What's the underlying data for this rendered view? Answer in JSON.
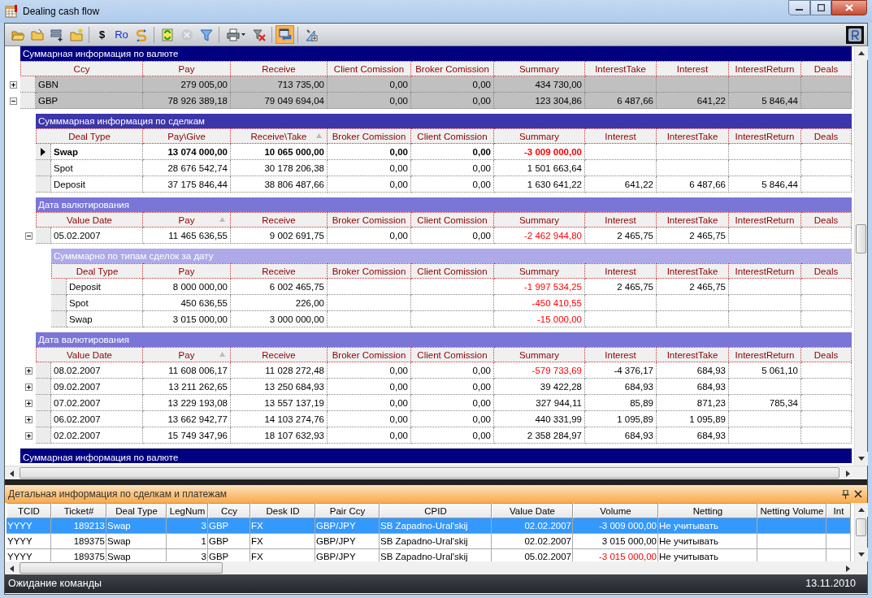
{
  "window": {
    "title": "Dealing cash flow"
  },
  "toolbar": [
    {
      "kind": "icon",
      "on": false,
      "disabled": false
    },
    {
      "kind": "icon",
      "on": false,
      "disabled": false
    },
    {
      "kind": "icon",
      "on": false,
      "disabled": false
    },
    {
      "kind": "icon",
      "on": false,
      "disabled": false
    },
    {
      "kind": "separator"
    },
    {
      "kind": "text",
      "label": "$"
    },
    {
      "kind": "text",
      "label": "Ro"
    },
    {
      "kind": "icon",
      "on": false,
      "disabled": false
    },
    {
      "kind": "separator"
    },
    {
      "kind": "icon",
      "on": false,
      "disabled": false
    },
    {
      "kind": "icon",
      "on": false,
      "disabled": true
    },
    {
      "kind": "icon",
      "on": false,
      "disabled": false
    },
    {
      "kind": "separator"
    },
    {
      "kind": "icon",
      "on": false,
      "disabled": false
    },
    {
      "kind": "icon",
      "on": false,
      "disabled": false
    },
    {
      "kind": "separator"
    },
    {
      "kind": "icon",
      "on": true,
      "disabled": false
    },
    {
      "kind": "separator"
    },
    {
      "kind": "icon",
      "on": false,
      "disabled": false
    }
  ],
  "grid": {
    "bands": [
      {
        "kind": "currency",
        "caption": "Суммарная информация по валюте",
        "columns": [
          {
            "label": "Ccy",
            "sorted": false
          },
          {
            "label": "Pay",
            "sorted": false
          },
          {
            "label": "Receive",
            "sorted": false
          },
          {
            "label": "Client Comission",
            "sorted": false
          },
          {
            "label": "Broker Comission",
            "sorted": false
          },
          {
            "label": "Summary",
            "sorted": false
          },
          {
            "label": "InterestTake",
            "sorted": false
          },
          {
            "label": "Interest",
            "sorted": false
          },
          {
            "label": "InterestReturn",
            "sorted": false
          },
          {
            "label": "Deals",
            "sorted": false
          }
        ],
        "rows": [
          {
            "expanded": false,
            "cells": [
              "GBN",
              "279 005,00",
              "713 735,00",
              "0,00",
              "0,00",
              "434 730,00",
              null,
              null,
              null,
              null
            ]
          },
          {
            "expanded": true,
            "cells": [
              "GBP",
              "78 926 389,18",
              "79 049 694,04",
              "0,00",
              "0,00",
              "123 304,86",
              "6 487,66",
              "641,22",
              "5 846,44",
              null
            ],
            "children": [
              {
                "kind": "deals",
                "caption": "Сумммарная информация по сделкам",
                "columns": [
                  {
                    "label": "Deal Type",
                    "sorted": false
                  },
                  {
                    "label": "Pay\\Give",
                    "sorted": false
                  },
                  {
                    "label": "Receive\\Take",
                    "sorted": true
                  },
                  {
                    "label": "Broker Comission",
                    "sorted": false
                  },
                  {
                    "label": "Client Comission",
                    "sorted": false
                  },
                  {
                    "label": "Summary",
                    "sorted": false
                  },
                  {
                    "label": "Interest",
                    "sorted": false
                  },
                  {
                    "label": "InterestTake",
                    "sorted": false
                  },
                  {
                    "label": "InterestReturn",
                    "sorted": false
                  },
                  {
                    "label": "Deals",
                    "sorted": false
                  }
                ],
                "rows": [
                  {
                    "selected": true,
                    "cells": [
                      "Swap",
                      "13 074 000,00",
                      "10 065 000,00",
                      "0,00",
                      "0,00",
                      {
                        "text": "-3 009 000,00",
                        "flagged": true
                      },
                      null,
                      null,
                      null,
                      null
                    ]
                  },
                  {
                    "selected": false,
                    "cells": [
                      "Spot",
                      "28 676 542,74",
                      "30 178 206,38",
                      "0,00",
                      "0,00",
                      "1 501 663,64",
                      null,
                      null,
                      null,
                      null
                    ]
                  },
                  {
                    "selected": false,
                    "cells": [
                      "Deposit",
                      "37 175 846,44",
                      "38 806 487,66",
                      "0,00",
                      "0,00",
                      "1 630 641,22",
                      "641,22",
                      "6 487,66",
                      "5 846,44",
                      null
                    ]
                  }
                ]
              },
              {
                "kind": "date",
                "caption": "Дата валютирования",
                "columns": [
                  {
                    "label": "Value Date",
                    "sorted": false
                  },
                  {
                    "label": "Pay",
                    "sorted": true
                  },
                  {
                    "label": "Receive",
                    "sorted": false
                  },
                  {
                    "label": "Broker Comission",
                    "sorted": false
                  },
                  {
                    "label": "Client Comission",
                    "sorted": false
                  },
                  {
                    "label": "Summary",
                    "sorted": false
                  },
                  {
                    "label": "Interest",
                    "sorted": false
                  },
                  {
                    "label": "InterestTake",
                    "sorted": false
                  },
                  {
                    "label": "InterestReturn",
                    "sorted": false
                  },
                  {
                    "label": "Deals",
                    "sorted": false
                  }
                ],
                "rows": [
                  {
                    "expanded": true,
                    "cells": [
                      "05.02.2007",
                      "11 465 636,55",
                      "9 002 691,75",
                      "0,00",
                      "0,00",
                      {
                        "text": "-2 462 944,80",
                        "flagged": true
                      },
                      "2 465,75",
                      "2 465,75",
                      null,
                      null
                    ],
                    "children": [
                      {
                        "kind": "date_deals",
                        "caption": "Сумммарно по типам сделок за дату",
                        "columns": [
                          {
                            "label": "Deal Type",
                            "sorted": false
                          },
                          {
                            "label": "Pay",
                            "sorted": false
                          },
                          {
                            "label": "Receive",
                            "sorted": false
                          },
                          {
                            "label": "Broker Comission",
                            "sorted": false
                          },
                          {
                            "label": "Client Comission",
                            "sorted": false
                          },
                          {
                            "label": "Summary",
                            "sorted": false
                          },
                          {
                            "label": "Interest",
                            "sorted": false
                          },
                          {
                            "label": "InterestTake",
                            "sorted": false
                          },
                          {
                            "label": "InterestReturn",
                            "sorted": false
                          },
                          {
                            "label": "Deals",
                            "sorted": false
                          }
                        ],
                        "rows": [
                          {
                            "cells": [
                              "Deposit",
                              "8 000 000,00",
                              "6 002 465,75",
                              null,
                              null,
                              {
                                "text": "-1 997 534,25",
                                "flagged": true
                              },
                              "2 465,75",
                              "2 465,75",
                              null,
                              null
                            ]
                          },
                          {
                            "cells": [
                              "Spot",
                              "450 636,55",
                              "226,00",
                              null,
                              null,
                              {
                                "text": "-450 410,55",
                                "flagged": true
                              },
                              null,
                              null,
                              null,
                              null
                            ]
                          },
                          {
                            "cells": [
                              "Swap",
                              "3 015 000,00",
                              "3 000 000,00",
                              null,
                              null,
                              {
                                "text": "-15 000,00",
                                "flagged": true
                              },
                              null,
                              null,
                              null,
                              null
                            ]
                          }
                        ]
                      }
                    ]
                  }
                ]
              },
              {
                "kind": "date",
                "caption": "Дата валютирования",
                "columns": [
                  {
                    "label": "Value Date",
                    "sorted": false
                  },
                  {
                    "label": "Pay",
                    "sorted": true
                  },
                  {
                    "label": "Receive",
                    "sorted": false
                  },
                  {
                    "label": "Broker Comission",
                    "sorted": false
                  },
                  {
                    "label": "Client Comission",
                    "sorted": false
                  },
                  {
                    "label": "Summary",
                    "sorted": false
                  },
                  {
                    "label": "Interest",
                    "sorted": false
                  },
                  {
                    "label": "InterestTake",
                    "sorted": false
                  },
                  {
                    "label": "InterestReturn",
                    "sorted": false
                  },
                  {
                    "label": "Deals",
                    "sorted": false
                  }
                ],
                "rows": [
                  {
                    "expanded": false,
                    "cells": [
                      "08.02.2007",
                      "11 608 006,17",
                      "11 028 272,48",
                      "0,00",
                      "0,00",
                      {
                        "text": "-579 733,69",
                        "flagged": true
                      },
                      "-4 376,17",
                      "684,93",
                      "5 061,10",
                      null
                    ]
                  },
                  {
                    "expanded": false,
                    "cells": [
                      "09.02.2007",
                      "13 211 262,65",
                      "13 250 684,93",
                      "0,00",
                      "0,00",
                      "39 422,28",
                      "684,93",
                      "684,93",
                      null,
                      null
                    ]
                  },
                  {
                    "expanded": false,
                    "cells": [
                      "07.02.2007",
                      "13 229 193,08",
                      "13 557 137,19",
                      "0,00",
                      "0,00",
                      "327 944,11",
                      "85,89",
                      "871,23",
                      "785,34",
                      null
                    ]
                  },
                  {
                    "expanded": false,
                    "cells": [
                      "06.02.2007",
                      "13 662 942,77",
                      "14 103 274,76",
                      "0,00",
                      "0,00",
                      "440 331,99",
                      "1 095,89",
                      "1 095,89",
                      null,
                      null
                    ]
                  },
                  {
                    "expanded": false,
                    "cells": [
                      "02.02.2007",
                      "15 749 347,96",
                      "18 107 632,93",
                      "0,00",
                      "0,00",
                      "2 358 284,97",
                      "684,93",
                      "684,93",
                      null,
                      null
                    ]
                  }
                ]
              }
            ]
          }
        ]
      },
      {
        "kind": "currency",
        "caption": "Суммарная информация по валюте"
      }
    ]
  },
  "detail": {
    "title": "Детальная информация по сделкам и платежам",
    "columns": [
      "TCID",
      "Ticket#",
      "Deal Type",
      "LegNum",
      "Ccy",
      "Desk ID",
      "Pair Ccy",
      "CPID",
      "Value Date",
      "Volume",
      "Netting",
      "Netting Volume",
      "Int"
    ],
    "rows": [
      {
        "selected": true,
        "cells": [
          "YYYY",
          "189213",
          "Swap",
          "3",
          "GBP",
          "FX",
          "GBP/JPY",
          "SB Zapadno-Ural'skij",
          "02.02.2007",
          "-3 009 000,00",
          "Не учитывать",
          null,
          null
        ]
      },
      {
        "selected": false,
        "cells": [
          "YYYY",
          "189375",
          "Swap",
          "1",
          "GBP",
          "FX",
          "GBP/JPY",
          "SB Zapadno-Ural'skij",
          "02.02.2007",
          "3 015 000,00",
          "Не учитывать",
          null,
          null
        ]
      },
      {
        "selected": false,
        "cells": [
          "YYYY",
          "189375",
          "Swap",
          "3",
          "GBP",
          "FX",
          "GBP/JPY",
          "SB Zapadno-Ural'skij",
          "05.02.2007",
          {
            "text": "-3 015 000,00",
            "flagged": true
          },
          "Не учитывать",
          null,
          null
        ]
      }
    ]
  },
  "status_bar": {
    "message": "Ожидание команды",
    "date": "13.11.2010"
  }
}
